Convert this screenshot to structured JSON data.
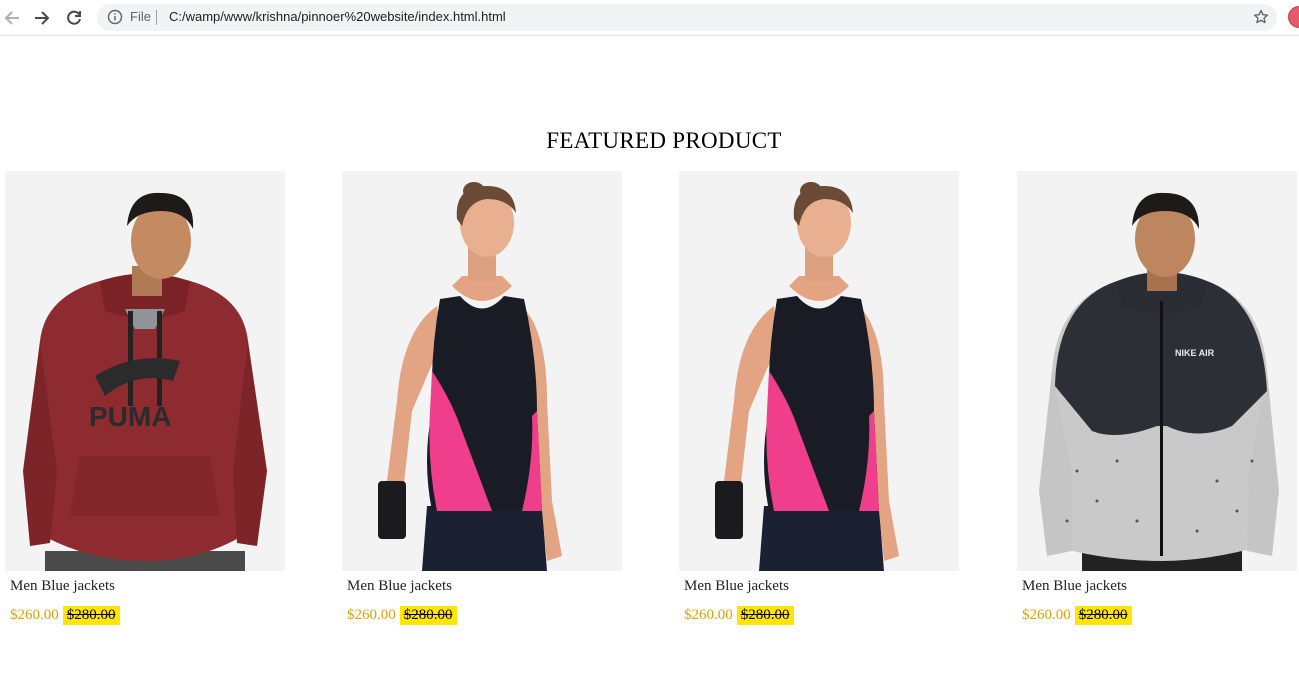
{
  "browser": {
    "scheme_label": "File",
    "url": "C:/wamp/www/krishna/pinnoer%20website/index.html.html",
    "icons": {
      "back": "arrow-left-icon",
      "forward": "arrow-right-icon",
      "reload": "reload-icon",
      "info": "info-icon",
      "bookmark": "star-icon"
    }
  },
  "featured": {
    "title": "FEATURED PRODUCT",
    "products": [
      {
        "image": "man-maroon-hoodie",
        "name": "Men Blue jackets",
        "price": "$260.00",
        "old_price": "$280.00"
      },
      {
        "image": "woman-pink-black-tank",
        "name": "Men Blue jackets",
        "price": "$260.00",
        "old_price": "$280.00"
      },
      {
        "image": "woman-pink-black-tank",
        "name": "Men Blue jackets",
        "price": "$260.00",
        "old_price": "$280.00"
      },
      {
        "image": "man-grey-black-jacket",
        "name": "Men Blue jackets",
        "price": "$260.00",
        "old_price": "$280.00"
      }
    ]
  },
  "colors": {
    "price": "#e0a100",
    "old_price_highlight": "#ffe600",
    "image_background": "#f3f3f3"
  }
}
